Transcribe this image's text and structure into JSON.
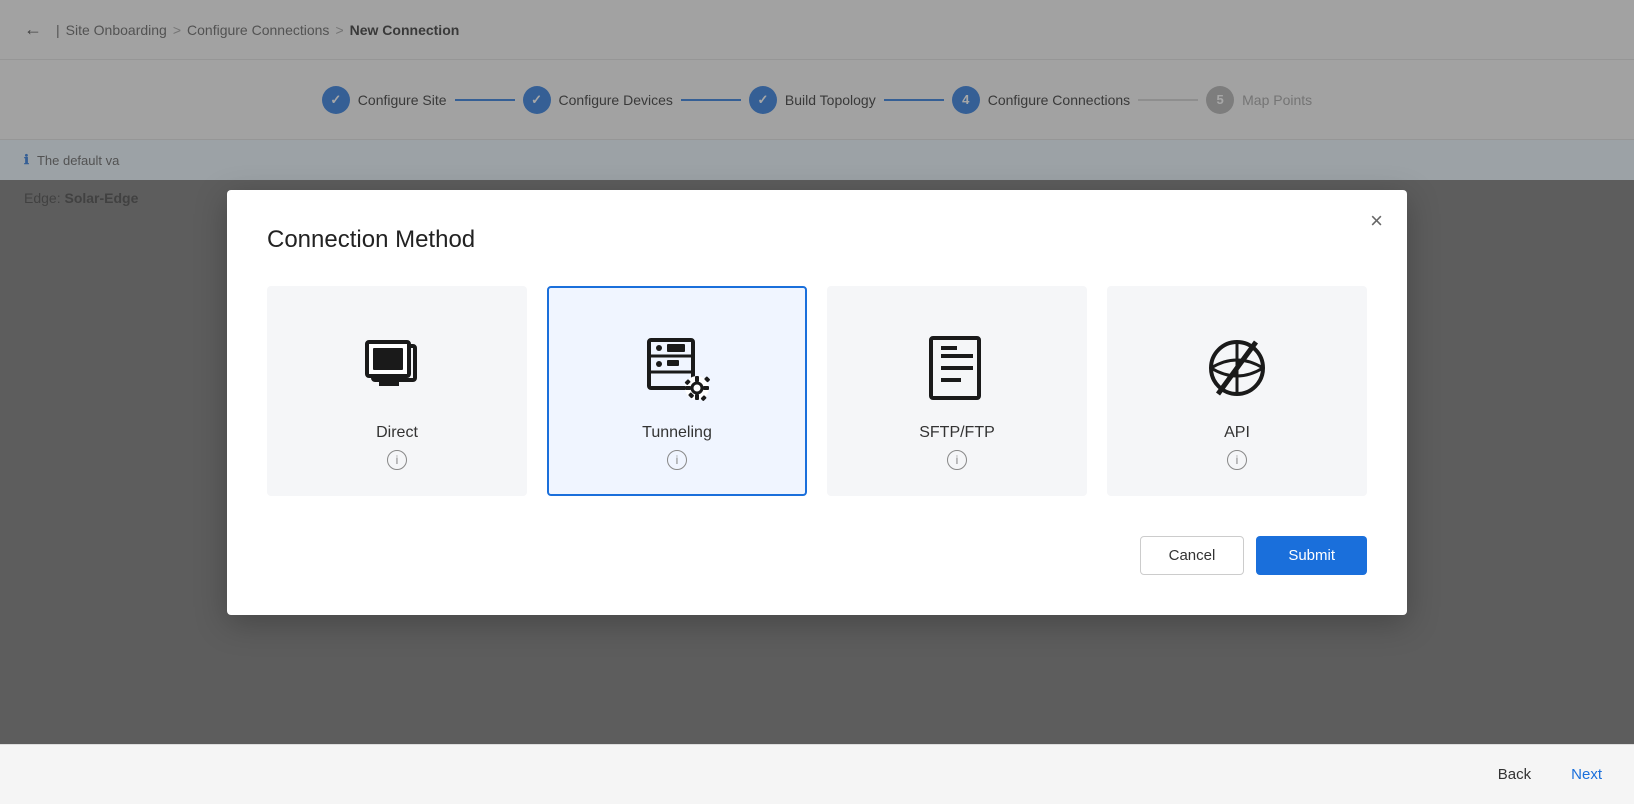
{
  "breadcrumb": {
    "back_label": "←",
    "items": [
      {
        "label": "Site Onboarding"
      },
      {
        "label": "Configure Connections"
      },
      {
        "label": "New Connection",
        "current": true
      }
    ],
    "separators": [
      ">",
      ">"
    ]
  },
  "stepper": {
    "steps": [
      {
        "id": 1,
        "label": "Configure Site",
        "state": "done",
        "icon": "✓"
      },
      {
        "id": 2,
        "label": "Configure Devices",
        "state": "done",
        "icon": "✓"
      },
      {
        "id": 3,
        "label": "Build Topology",
        "state": "done",
        "icon": "✓"
      },
      {
        "id": 4,
        "label": "Configure Connections",
        "state": "active",
        "number": "4"
      },
      {
        "id": 5,
        "label": "Map Points",
        "state": "inactive",
        "number": "5"
      }
    ]
  },
  "info_bar": {
    "icon": "ℹ",
    "text": "The default va"
  },
  "edge_bar": {
    "label": "Edge:",
    "value": "Solar-Edge"
  },
  "modal": {
    "title": "Connection Method",
    "close_label": "×",
    "methods": [
      {
        "id": "direct",
        "label": "Direct",
        "selected": false
      },
      {
        "id": "tunneling",
        "label": "Tunneling",
        "selected": true
      },
      {
        "id": "sftp_ftp",
        "label": "SFTP/FTP",
        "selected": false
      },
      {
        "id": "api",
        "label": "API",
        "selected": false
      }
    ],
    "cancel_label": "Cancel",
    "submit_label": "Submit"
  },
  "bottom_bar": {
    "back_label": "Back",
    "next_label": "Next"
  }
}
